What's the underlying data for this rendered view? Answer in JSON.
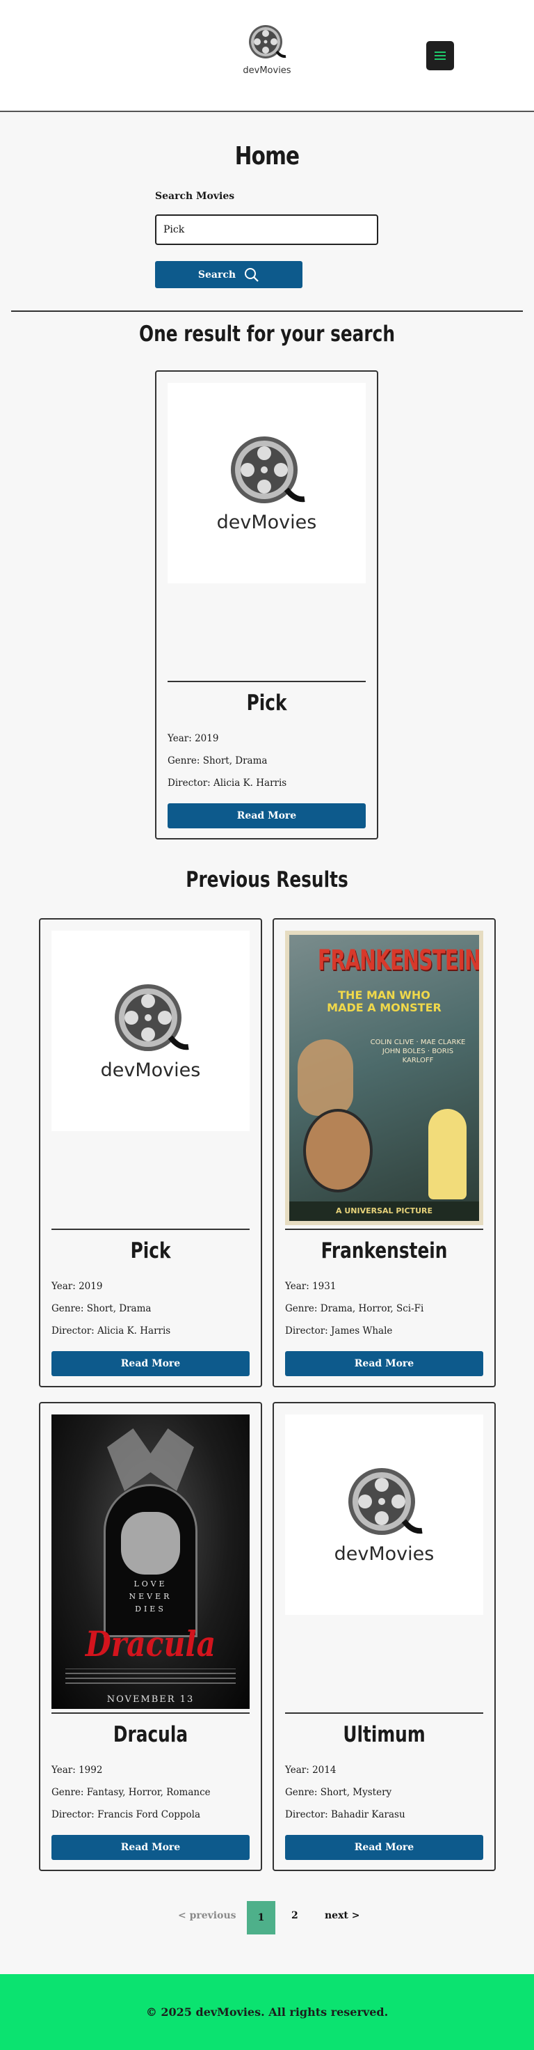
{
  "header": {
    "brand_name": "devMovies",
    "menu_icon": "hamburger-icon",
    "accent_color": "#1ecb6b"
  },
  "home": {
    "title": "Home",
    "search_label": "Search Movies",
    "search_value": "Pick",
    "search_button": "Search",
    "search_icon": "search-icon",
    "result_heading": "One result for your search"
  },
  "placeholder_text": "devMovies",
  "result_card": {
    "title": "Pick",
    "year": "Year: 2019",
    "genre": "Genre: Short, Drama",
    "director": "Director: Alicia K. Harris",
    "button": "Read More",
    "poster": "placeholder"
  },
  "previous": {
    "heading": "Previous Results",
    "cards": [
      {
        "title": "Pick",
        "year": "Year: 2019",
        "genre": "Genre: Short, Drama",
        "director": "Director: Alicia K. Harris",
        "button": "Read More",
        "poster": "placeholder"
      },
      {
        "title": "Frankenstein",
        "year": "Year: 1931",
        "genre": "Genre: Drama, Horror, Sci-Fi",
        "director": "Director: James Whale",
        "button": "Read More",
        "poster": "frankenstein"
      },
      {
        "title": "Dracula",
        "year": "Year: 1992",
        "genre": "Genre: Fantasy, Horror, Romance",
        "director": "Director: Francis Ford Coppola",
        "button": "Read More",
        "poster": "dracula"
      },
      {
        "title": "Ultimum",
        "year": "Year: 2014",
        "genre": "Genre: Short, Mystery",
        "director": "Director: Bahadir Karasu",
        "button": "Read More",
        "poster": "placeholder"
      }
    ]
  },
  "frankenstein_poster": {
    "title": "FRANKENSTEIN",
    "tagline_1": "THE MAN WHO",
    "tagline_2": "MADE A MONSTER",
    "cast_1": "COLIN CLIVE · MAE CLARKE",
    "cast_2": "JOHN BOLES · BORIS KARLOFF",
    "studio": "A UNIVERSAL PICTURE"
  },
  "dracula_poster": {
    "love_1": "LOVE",
    "love_2": "NEVER",
    "love_3": "DIES",
    "title": "Dracula",
    "date": "NOVEMBER 13"
  },
  "pagination": {
    "prev": "< previous",
    "page_1": "1",
    "page_2": "2",
    "next": "next >",
    "active_color": "#4eb08a"
  },
  "footer": {
    "text": "© 2025 devMovies. All rights reserved.",
    "background": "#0be370"
  }
}
